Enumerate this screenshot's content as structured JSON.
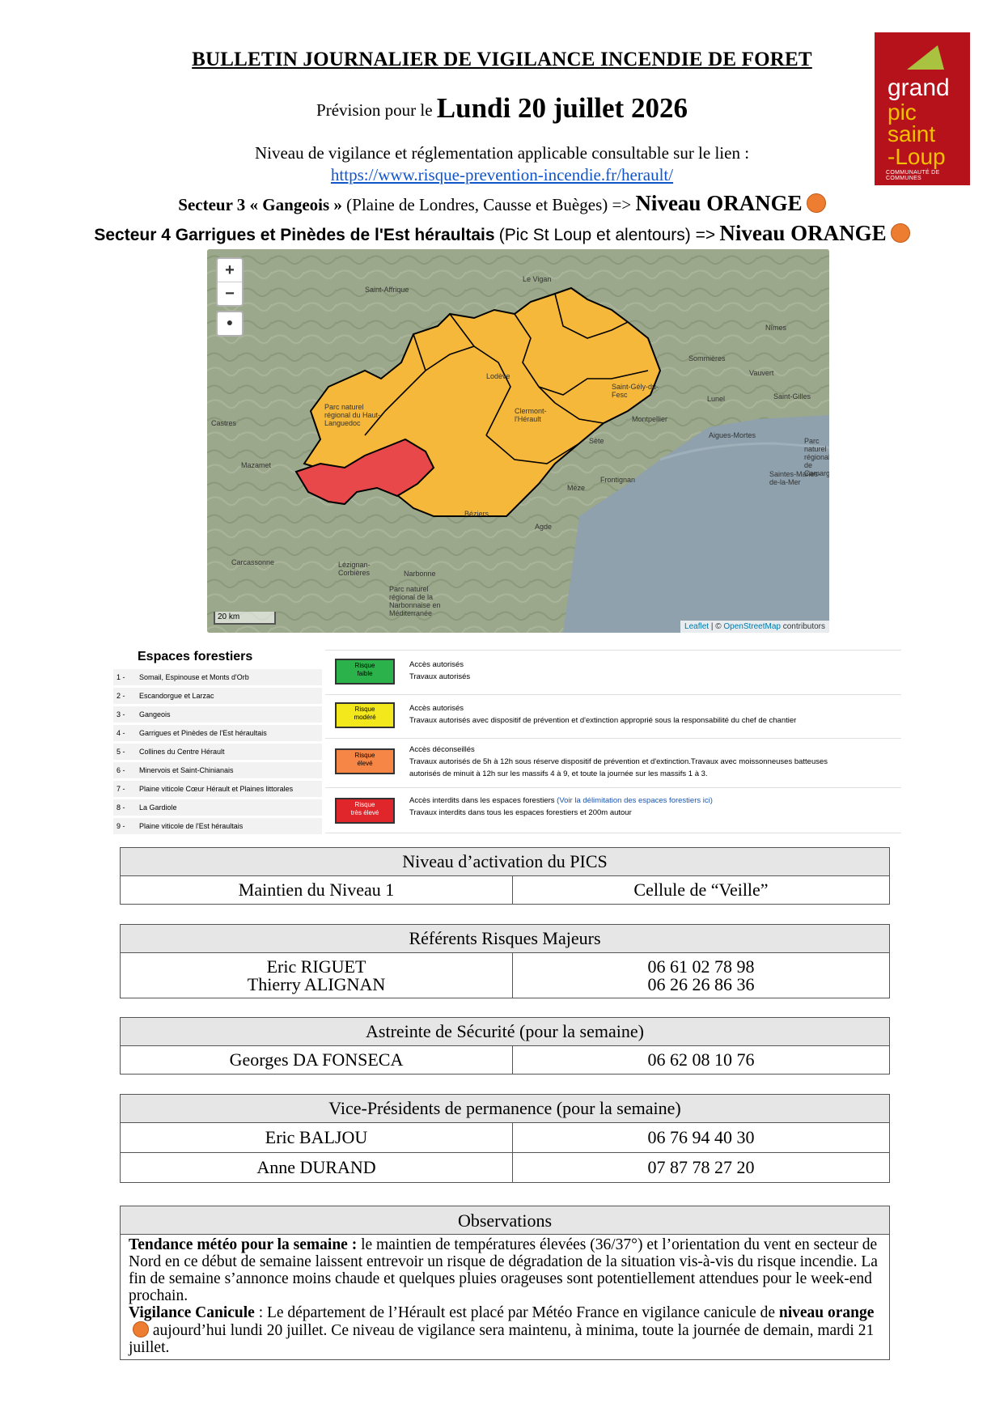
{
  "header": {
    "title": "BULLETIN JOURNALIER DE VIGILANCE INCENDIE DE FORET",
    "prevision_prefix": "Prévision pour le",
    "date": "Lundi 20 juillet 2026",
    "niveau_line": "Niveau de vigilance et réglementation applicable consultable sur le lien :",
    "link": "https://www.risque-prevention-incendie.fr/herault/"
  },
  "sectors": [
    {
      "label_bold": "Secteur 3 « Gangeois »",
      "label_rest": "(Plaine de Londres, Causse et Buèges) =>",
      "level": "Niveau ORANGE",
      "level_color": "#ed7d31"
    },
    {
      "label_bold": "Secteur 4 Garrigues et Pinèdes de l'Est héraultais",
      "label_rest": "(Pic St Loup et alentours) =>",
      "level": "Niveau ORANGE",
      "level_color": "#ed7d31"
    }
  ],
  "logo": {
    "line1": "grand",
    "line2": "pic",
    "line3": "saint",
    "line4": "-Loup",
    "subtitle": "COMMUNAUTÉ DE COMMUNES"
  },
  "map": {
    "zoom_in": "+",
    "zoom_out": "−",
    "scale": "20 km",
    "attribution_leaflet": "Leaflet",
    "attribution_osm": "OpenStreetMap",
    "attribution_rest": "contributors",
    "places": [
      "Saint-Affrique",
      "Le Vigan",
      "Nîmes",
      "Castres",
      "Mazamet",
      "Carcassonne",
      "Lézignan-Corbières",
      "Narbonne",
      "Béziers",
      "Agde",
      "Sète",
      "Montpellier",
      "Lunel",
      "Vauvert",
      "Saint-Gilles",
      "Aigues-Mortes",
      "Saintes-Maries-de-la-Mer",
      "Frontignan",
      "Mèze",
      "Lodève",
      "Clermont-l'Hérault",
      "Saint-Gély-du-Fesc",
      "Sommières",
      "Parc naturel régional du Haut-Languedoc",
      "Parc naturel régional de la Narbonnaise en Méditerranée",
      "Parc naturel régional de Camargue"
    ],
    "colors": {
      "orange": "#f5b83a",
      "red": "#e8484a",
      "sea": "#8ea1ad",
      "land": "#9aa58b"
    }
  },
  "legend": {
    "title": "Espaces forestiers",
    "zones": [
      {
        "n": "1 -",
        "name": "Somail, Espinouse et Monts d'Orb"
      },
      {
        "n": "2 -",
        "name": "Escandorgue et Larzac"
      },
      {
        "n": "3 -",
        "name": "Gangeois"
      },
      {
        "n": "4 -",
        "name": "Garrigues et Pinèdes de l'Est héraultais"
      },
      {
        "n": "5 -",
        "name": "Collines du Centre Hérault"
      },
      {
        "n": "6 -",
        "name": "Minervois et Saint-Chinianais"
      },
      {
        "n": "7 -",
        "name": "Plaine viticole Cœur Hérault et Plaines littorales"
      },
      {
        "n": "8 -",
        "name": "La Gardiole"
      },
      {
        "n": "9 -",
        "name": "Plaine viticole de l'Est héraultais"
      }
    ],
    "risks": [
      {
        "box1": "Risque",
        "box2": "faible",
        "color": "#2cb24a",
        "line1": "Accès autorisés",
        "line2": "Travaux autorisés",
        "line3": ""
      },
      {
        "box1": "Risque",
        "box2": "modéré",
        "color": "#f2e81c",
        "line1": "Accès autorisés",
        "line2": "Travaux autorisés avec dispositif de prévention et d'extinction approprié sous la responsabilité du chef de chantier",
        "line3": ""
      },
      {
        "box1": "Risque",
        "box2": "élevé",
        "color": "#f58645",
        "line1": "Accès déconseillés",
        "line2": "Travaux autorisés de 5h à 12h sous réserve dispositif de prévention et d'extinction.Travaux avec moissonneuses batteuses",
        "line3": "autorisés de minuit à 12h sur les massifs 4 à 9, et toute la journée sur les massifs 1 à 3."
      },
      {
        "box1": "Risque",
        "box2": "très élevé",
        "color": "#e0262b",
        "line1": "Accès interdits dans les espaces forestiers",
        "line1_link": "(Voir la délimitation des espaces forestiers ici)",
        "line2": "Travaux interdits dans tous les espaces forestiers et 200m autour",
        "line3": ""
      }
    ]
  },
  "pics": {
    "header": "Niveau d’activation du PICS",
    "left": "Maintien du Niveau 1",
    "right": "Cellule de “Veille”"
  },
  "referents": {
    "header": "Référents Risques Majeurs",
    "people": [
      {
        "name": "Eric RIGUET",
        "phone": "06 61 02 78 98"
      },
      {
        "name": "Thierry ALIGNAN",
        "phone": "06 26 26 86 36"
      }
    ]
  },
  "astreinte": {
    "header": "Astreinte de Sécurité (pour la semaine)",
    "name": "Georges DA FONSECA",
    "phone": "06 62 08 10 76"
  },
  "vp": {
    "header": "Vice-Présidents de permanence (pour la semaine)",
    "people": [
      {
        "name": "Eric BALJOU",
        "phone": "06 76 94 40 30"
      },
      {
        "name": "Anne DURAND",
        "phone": "07 87 78 27 20"
      }
    ]
  },
  "observations": {
    "header": "Observations",
    "meteo_label": "Tendance météo pour la semaine :",
    "meteo_text": "le maintien de températures élevées (36/37°) et l’orientation du vent en secteur de Nord en ce début de semaine laissent entrevoir un risque de dégradation de la situation vis-à-vis du risque incendie. La fin de semaine s’annonce moins chaude et quelques pluies orageuses sont potentiellement attendues pour le week-end prochain.",
    "canicule_label": "Vigilance Canicule",
    "canicule_text1": ": Le département de l’Hérault est placé par Météo France en vigilance canicule de",
    "canicule_level": "niveau orange",
    "canicule_text2": "aujourd’hui lundi 20 juillet. Ce niveau de vigilance sera maintenu, à minima, toute la journée de demain, mardi 21 juillet."
  }
}
